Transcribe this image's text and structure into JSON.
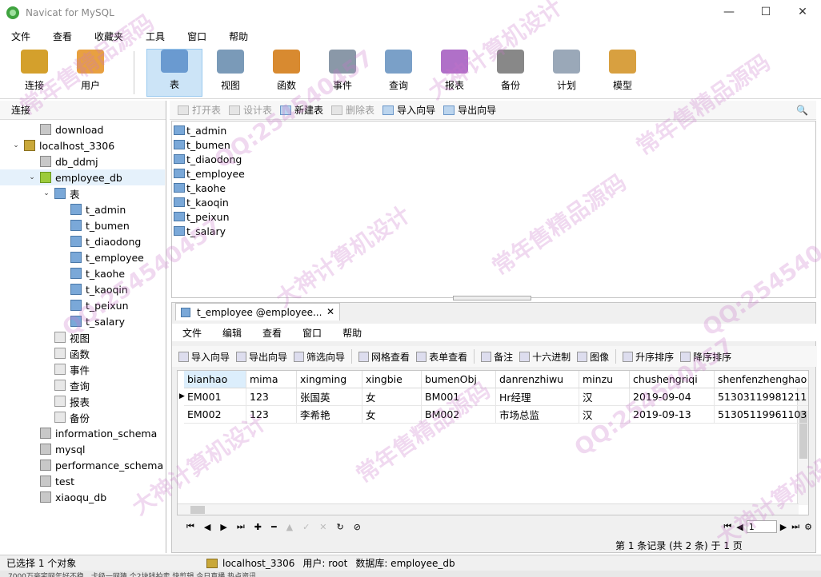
{
  "window": {
    "title": "Navicat for MySQL",
    "minimize": "—",
    "maximize": "☐",
    "close": "✕"
  },
  "menu": [
    "文件",
    "查看",
    "收藏夹",
    "工具",
    "窗口",
    "帮助"
  ],
  "toolbar": [
    {
      "label": "连接",
      "icon": "connection-icon",
      "color": "#d4a02c"
    },
    {
      "label": "用户",
      "icon": "user-icon",
      "color": "#e8a040"
    },
    {
      "label": "表",
      "icon": "table-icon",
      "color": "#6a9ad0",
      "active": true
    },
    {
      "label": "视图",
      "icon": "view-icon",
      "color": "#7a9ab8"
    },
    {
      "label": "函数",
      "icon": "function-icon",
      "color": "#d88a30"
    },
    {
      "label": "事件",
      "icon": "event-icon",
      "color": "#8a98a8"
    },
    {
      "label": "查询",
      "icon": "query-icon",
      "color": "#7aa0c8"
    },
    {
      "label": "报表",
      "icon": "report-icon",
      "color": "#b070c8"
    },
    {
      "label": "备份",
      "icon": "backup-icon",
      "color": "#888888"
    },
    {
      "label": "计划",
      "icon": "schedule-icon",
      "color": "#9aa8b8"
    },
    {
      "label": "模型",
      "icon": "model-icon",
      "color": "#d8a040"
    }
  ],
  "left": {
    "header": "连接",
    "tree": [
      {
        "label": "download",
        "level": 1,
        "icon": "db",
        "arrow": ""
      },
      {
        "label": "localhost_3306",
        "level": 0,
        "icon": "srv",
        "arrow": "⌄"
      },
      {
        "label": "db_ddmj",
        "level": 1,
        "icon": "db",
        "arrow": ""
      },
      {
        "label": "employee_db",
        "level": 1,
        "icon": "dbopen",
        "arrow": "⌄",
        "selected": true
      },
      {
        "label": "表",
        "level": 2,
        "icon": "tbl",
        "arrow": "⌄"
      },
      {
        "label": "t_admin",
        "level": 3,
        "icon": "tbl",
        "arrow": ""
      },
      {
        "label": "t_bumen",
        "level": 3,
        "icon": "tbl",
        "arrow": ""
      },
      {
        "label": "t_diaodong",
        "level": 3,
        "icon": "tbl",
        "arrow": ""
      },
      {
        "label": "t_employee",
        "level": 3,
        "icon": "tbl",
        "arrow": ""
      },
      {
        "label": "t_kaohe",
        "level": 3,
        "icon": "tbl",
        "arrow": ""
      },
      {
        "label": "t_kaoqin",
        "level": 3,
        "icon": "tbl",
        "arrow": ""
      },
      {
        "label": "t_peixun",
        "level": 3,
        "icon": "tbl",
        "arrow": ""
      },
      {
        "label": "t_salary",
        "level": 3,
        "icon": "tbl",
        "arrow": ""
      },
      {
        "label": "视图",
        "level": 2,
        "icon": "view",
        "arrow": ""
      },
      {
        "label": "函数",
        "level": 2,
        "icon": "view",
        "arrow": ""
      },
      {
        "label": "事件",
        "level": 2,
        "icon": "view",
        "arrow": ""
      },
      {
        "label": "查询",
        "level": 2,
        "icon": "view",
        "arrow": ""
      },
      {
        "label": "报表",
        "level": 2,
        "icon": "view",
        "arrow": ""
      },
      {
        "label": "备份",
        "level": 2,
        "icon": "view",
        "arrow": ""
      },
      {
        "label": "information_schema",
        "level": 1,
        "icon": "db",
        "arrow": ""
      },
      {
        "label": "mysql",
        "level": 1,
        "icon": "db",
        "arrow": ""
      },
      {
        "label": "performance_schema",
        "level": 1,
        "icon": "db",
        "arrow": ""
      },
      {
        "label": "test",
        "level": 1,
        "icon": "db",
        "arrow": ""
      },
      {
        "label": "xiaoqu_db",
        "level": 1,
        "icon": "db",
        "arrow": ""
      }
    ]
  },
  "objbar": [
    {
      "label": "打开表",
      "disabled": true
    },
    {
      "label": "设计表",
      "disabled": true
    },
    {
      "label": "新建表",
      "disabled": false
    },
    {
      "label": "删除表",
      "disabled": true
    },
    {
      "label": "导入向导",
      "disabled": false
    },
    {
      "label": "导出向导",
      "disabled": false
    }
  ],
  "objects": [
    "t_admin",
    "t_bumen",
    "t_diaodong",
    "t_employee",
    "t_kaohe",
    "t_kaoqin",
    "t_peixun",
    "t_salary"
  ],
  "editor": {
    "tab": "t_employee @employee...",
    "tab_close": "✕",
    "menu": [
      "文件",
      "编辑",
      "查看",
      "窗口",
      "帮助"
    ],
    "tools": [
      "导入向导",
      "导出向导",
      "筛选向导",
      "网格查看",
      "表单查看",
      "备注",
      "十六进制",
      "图像",
      "升序排序",
      "降序排序"
    ],
    "columns": [
      "bianhao",
      "mima",
      "xingming",
      "xingbie",
      "bumenObj",
      "danrenzhiwu",
      "minzu",
      "chushengriqi",
      "shenfenzhenghao"
    ],
    "rows": [
      [
        "EM001",
        "123",
        "张国英",
        "女",
        "BM001",
        "Hr经理",
        "汉",
        "2019-09-04",
        "51303119981211"
      ],
      [
        "EM002",
        "123",
        "李希艳",
        "女",
        "BM002",
        "市场总监",
        "汉",
        "2019-09-13",
        "51305119961103"
      ]
    ],
    "nav": [
      "⏮",
      "◀",
      "▶",
      "⏭",
      "✚",
      "━",
      "▲",
      "✓",
      "✕",
      "↻",
      "⊘"
    ],
    "page": "1",
    "record_info": "第 1 条记录 (共 2 条) 于 1 页"
  },
  "status": {
    "selection": "已选择 1 个对象",
    "connection": "localhost_3306",
    "user": "用户: root",
    "database": "数据库: employee_db"
  },
  "taskbar_text": "7000万豪宅网年好不稳，卡级一网猜  个2块钱拍卖      快剪辑      今日直播      热点资讯"
}
